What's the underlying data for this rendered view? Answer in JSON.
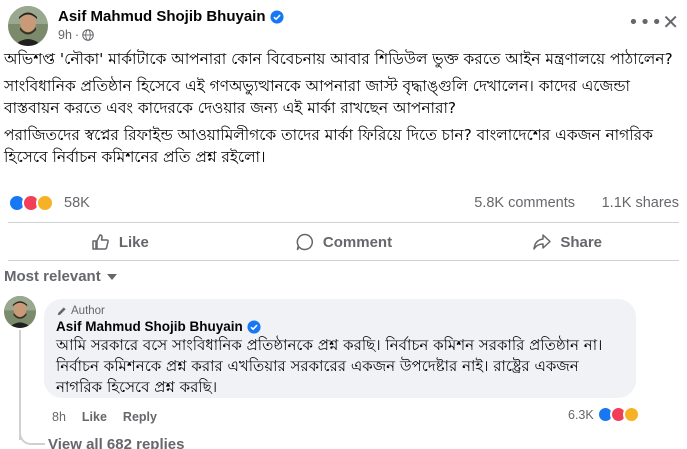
{
  "post": {
    "author": "Asif Mahmud Shojib Bhuyain",
    "time": "9h",
    "icons": {
      "verified": "verified-badge-icon",
      "audience": "globe-icon",
      "more": "more-options-icon",
      "close": "close-icon"
    },
    "paragraphs": [
      "অভিশপ্ত 'নৌকা' মার্কাটাকে আপনারা কোন বিবেচনায় আবার শিডিউল ভুক্ত করতে আইন মন্ত্রণালয়ে পাঠালেন?",
      "সাংবিধানিক প্রতিষ্ঠান হিসেবে এই গণঅভ্যুত্থানকে আপনারা জাস্ট বৃদ্ধাঙ্গুলি দেখালেন। কাদের এজেন্ডা বাস্তবায়ন করতে এবং কাদেরকে দেওয়ার জন্য এই মার্কা রাখছেন আপনারা?",
      "পরাজিতদের স্বপ্নের রিফাইন্ড আওয়ামিলীগকে তাদের মার্কা ফিরিয়ে দিতে চান? বাংলাদেশের একজন নাগরিক হিসেবে নির্বাচন কমিশনের প্রতি প্রশ্ন রইলো।"
    ],
    "reactions_count": "58K",
    "comments_count": "5.8K comments",
    "shares_count": "1.1K shares",
    "colors": {
      "like": "#1877f2",
      "love": "#f33e58",
      "haha": "#f7b125",
      "muted": "#65676b"
    }
  },
  "actions": {
    "like": "Like",
    "comment": "Comment",
    "share": "Share"
  },
  "sort_label": "Most relevant",
  "comment": {
    "badge": "Author",
    "author": "Asif Mahmud Shojib Bhuyain",
    "text": "আমি সরকারে বসে সাংবিধানিক প্রতিষ্ঠানকে প্রশ্ন করছি। নির্বাচন কমিশন সরকারি প্রতিষ্ঠান না। নির্বাচন কমিশনকে প্রশ্ন করার এখতিয়ার সরকারের একজন উপদেষ্টার নাই। রাষ্ট্রের একজন নাগরিক হিসেবে প্রশ্ন করছি।",
    "time": "8h",
    "like": "Like",
    "reply": "Reply",
    "reactions_count": "6.3K"
  },
  "view_replies": "View all 682 replies"
}
